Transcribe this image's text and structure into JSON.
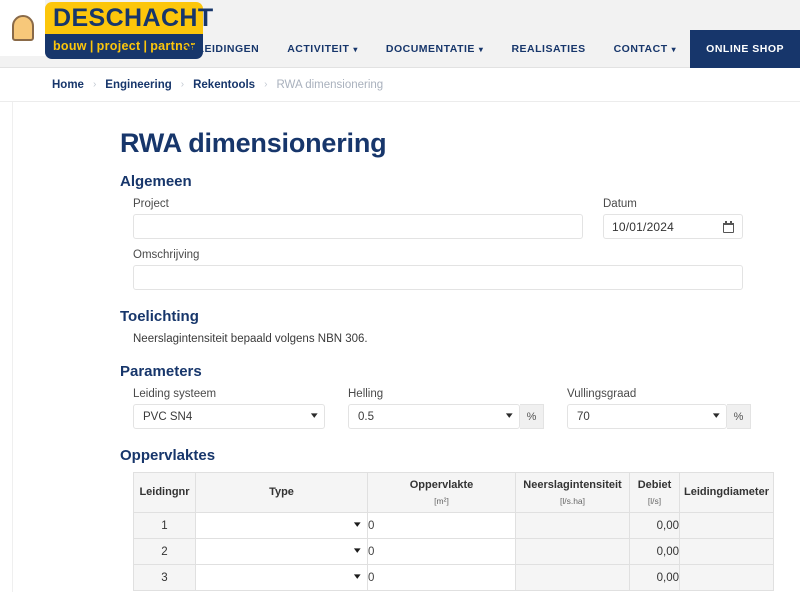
{
  "header": {
    "logo": {
      "brand_icon": "bell-icon",
      "name": "DESCHACHT",
      "tagline": [
        "bouw",
        "project",
        "partner"
      ],
      "separator": "|",
      "colors": {
        "yellow": "#fcc60b",
        "navy": "#17366b"
      }
    },
    "nav": [
      {
        "label": "OPLEIDINGEN",
        "has_dropdown": false
      },
      {
        "label": "ACTIVITEIT",
        "has_dropdown": true
      },
      {
        "label": "DOCUMENTATIE",
        "has_dropdown": true
      },
      {
        "label": "REALISATIES",
        "has_dropdown": false
      },
      {
        "label": "CONTACT",
        "has_dropdown": true
      }
    ],
    "shop_button": "ONLINE SHOP"
  },
  "breadcrumb": {
    "separator": "›",
    "items": [
      {
        "label": "Home",
        "current": false
      },
      {
        "label": "Engineering",
        "current": false
      },
      {
        "label": "Rekentools",
        "current": false
      },
      {
        "label": "RWA dimensionering",
        "current": true
      }
    ]
  },
  "main": {
    "title": "RWA dimensionering",
    "sections": {
      "algemeen": {
        "heading": "Algemeen",
        "project": {
          "label": "Project",
          "value": "",
          "placeholder": ""
        },
        "datum": {
          "label": "Datum",
          "value": "10/01/2024",
          "icon": "calendar-icon"
        },
        "omschrijving": {
          "label": "Omschrijving",
          "value": "",
          "placeholder": ""
        }
      },
      "toelichting": {
        "heading": "Toelichting",
        "text": "Neerslagintensiteit bepaald volgens NBN 306."
      },
      "parameters": {
        "heading": "Parameters",
        "leiding_systeem": {
          "label": "Leiding systeem",
          "value": "PVC SN4",
          "unit": ""
        },
        "helling": {
          "label": "Helling",
          "value": "0.5",
          "unit": "%"
        },
        "vullingsgraad": {
          "label": "Vullingsgraad",
          "value": "70",
          "unit": "%"
        }
      },
      "oppervlaktes": {
        "heading": "Oppervlaktes",
        "columns": [
          {
            "label": "Leidingnr",
            "unit": ""
          },
          {
            "label": "Type",
            "unit": ""
          },
          {
            "label": "Oppervlakte",
            "unit": "[m²]"
          },
          {
            "label": "Neerslagintensiteit",
            "unit": "[l/s.ha]"
          },
          {
            "label": "Debiet",
            "unit": "[l/s]"
          },
          {
            "label": "Leidingdiameter",
            "unit": ""
          }
        ],
        "rows": [
          {
            "nr": "1",
            "type": "",
            "oppervlakte": "0",
            "neerslagintensiteit": "",
            "debiet": "0,00",
            "leidingdiameter": ""
          },
          {
            "nr": "2",
            "type": "",
            "oppervlakte": "0",
            "neerslagintensiteit": "",
            "debiet": "0,00",
            "leidingdiameter": ""
          },
          {
            "nr": "3",
            "type": "",
            "oppervlakte": "0",
            "neerslagintensiteit": "",
            "debiet": "0,00",
            "leidingdiameter": ""
          }
        ]
      }
    }
  }
}
